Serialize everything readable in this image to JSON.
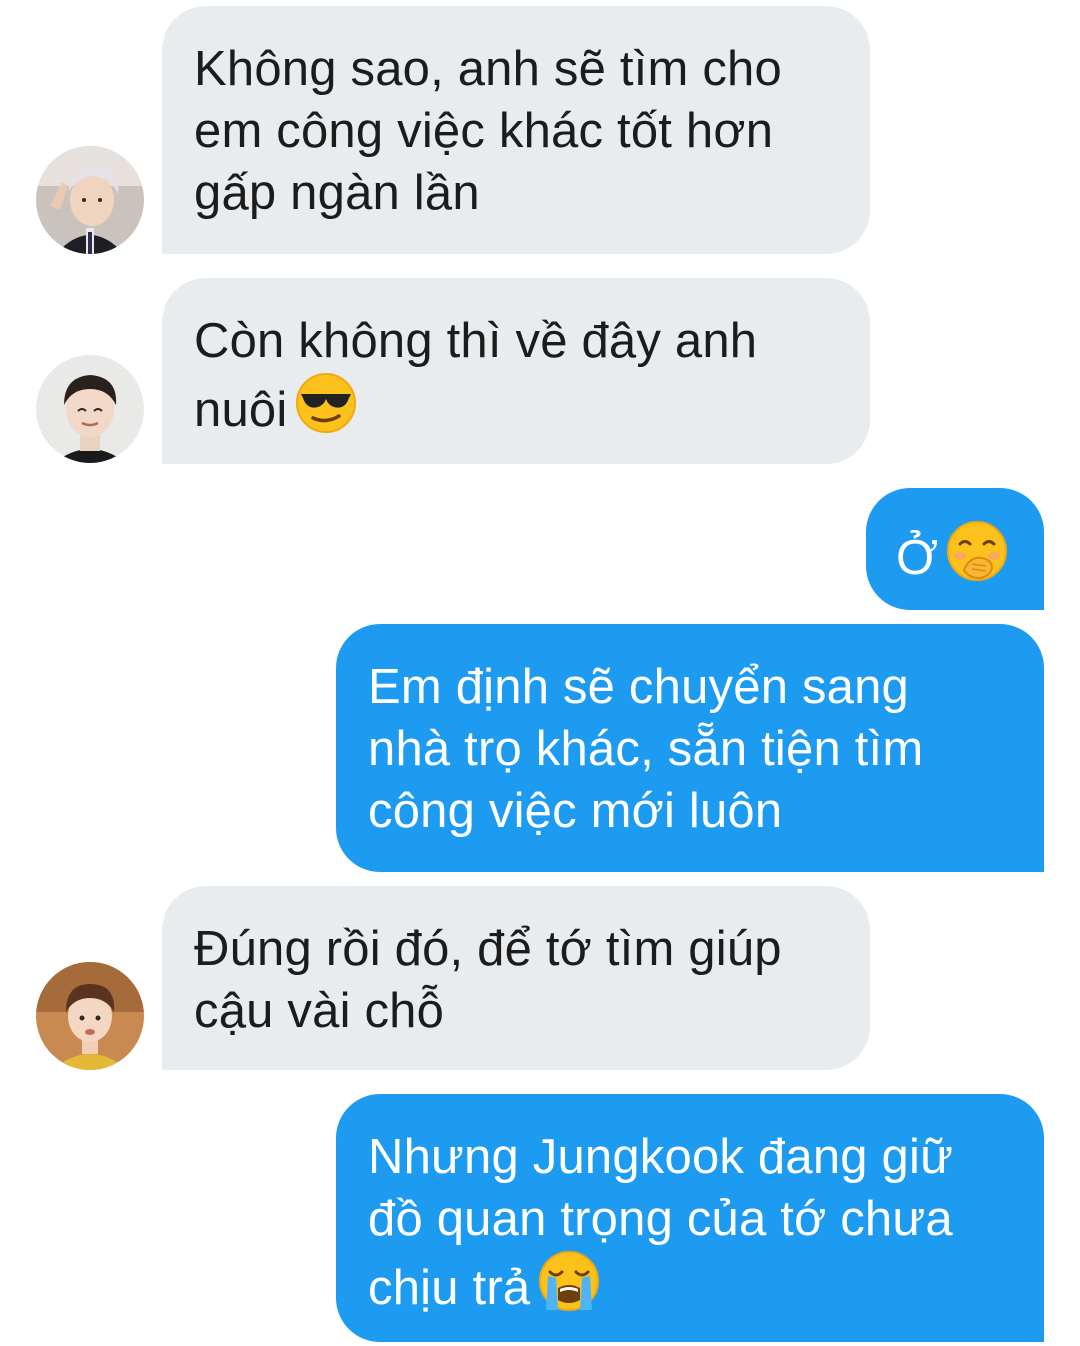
{
  "conversation": {
    "messages": [
      {
        "sender": "incoming",
        "text": "Không sao, anh sẽ tìm cho\nem công việc khác tốt hơn\ngấp ngàn lần",
        "avatar": "avatar-silver-hair"
      },
      {
        "sender": "incoming",
        "text": "Còn không thì về đây anh\nnuôi",
        "emoji": "sunglasses-emoji",
        "avatar": "avatar-dark-hair"
      },
      {
        "sender": "outgoing",
        "text": "Ở",
        "emoji": "hand-over-mouth-emoji"
      },
      {
        "sender": "outgoing",
        "text": "Em định sẽ chuyển sang\nnhà trọ khác, sẵn tiện tìm\ncông việc mới luôn"
      },
      {
        "sender": "incoming",
        "text": "Đúng rồi đó, để tớ tìm giúp\ncậu vài chỗ",
        "avatar": "avatar-brown-hair"
      },
      {
        "sender": "outgoing",
        "text": "Nhưng Jungkook đang giữ\nđồ quan trọng của tớ chưa\nchịu trả",
        "emoji": "loudly-crying-emoji"
      }
    ]
  },
  "colors": {
    "incoming_bubble": "#e8ecef",
    "outgoing_bubble": "#1d9bf0",
    "incoming_text": "#1c1c1c",
    "outgoing_text": "#ffffff",
    "background": "#ffffff"
  }
}
